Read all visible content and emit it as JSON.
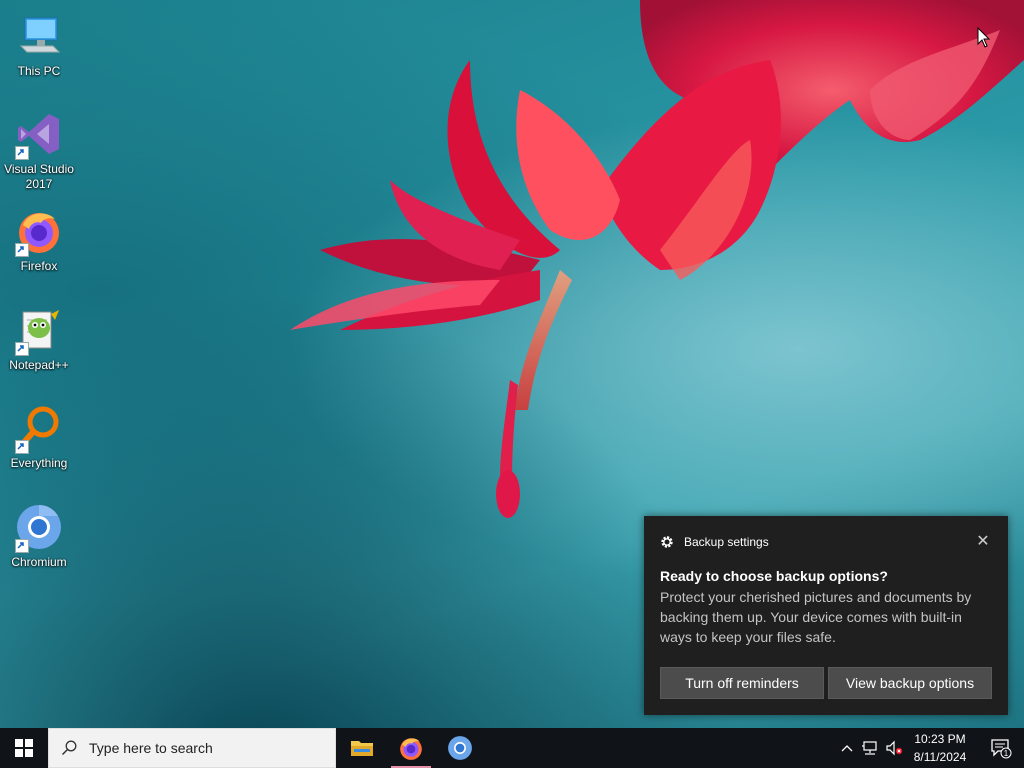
{
  "desktop": {
    "icons": [
      {
        "label": "This PC",
        "icon": "this-pc-icon"
      },
      {
        "label": "Visual Studio 2017",
        "icon": "visual-studio-icon"
      },
      {
        "label": "Firefox",
        "icon": "firefox-icon"
      },
      {
        "label": "Notepad++",
        "icon": "notepadpp-icon"
      },
      {
        "label": "Everything",
        "icon": "everything-icon"
      },
      {
        "label": "Chromium",
        "icon": "chromium-icon"
      }
    ]
  },
  "toast": {
    "app_name": "Backup settings",
    "title": "Ready to choose backup options?",
    "body": "Protect your cherished pictures and documents by backing them up. Your device comes with built-in ways to keep your files safe.",
    "button_primary": "Turn off reminders",
    "button_secondary": "View backup options",
    "close_glyph": "✕"
  },
  "taskbar": {
    "search_placeholder": "Type here to search",
    "pinned": [
      "file-explorer-icon",
      "firefox-icon",
      "chromium-icon"
    ],
    "clock_time": "10:23 PM",
    "clock_date": "8/11/2024",
    "notification_count": "1",
    "accent": "#e68fa9"
  },
  "colors": {
    "taskbar_bg": "#101418",
    "toast_bg": "#1f1f1f",
    "toast_button": "#4c4c4c"
  }
}
